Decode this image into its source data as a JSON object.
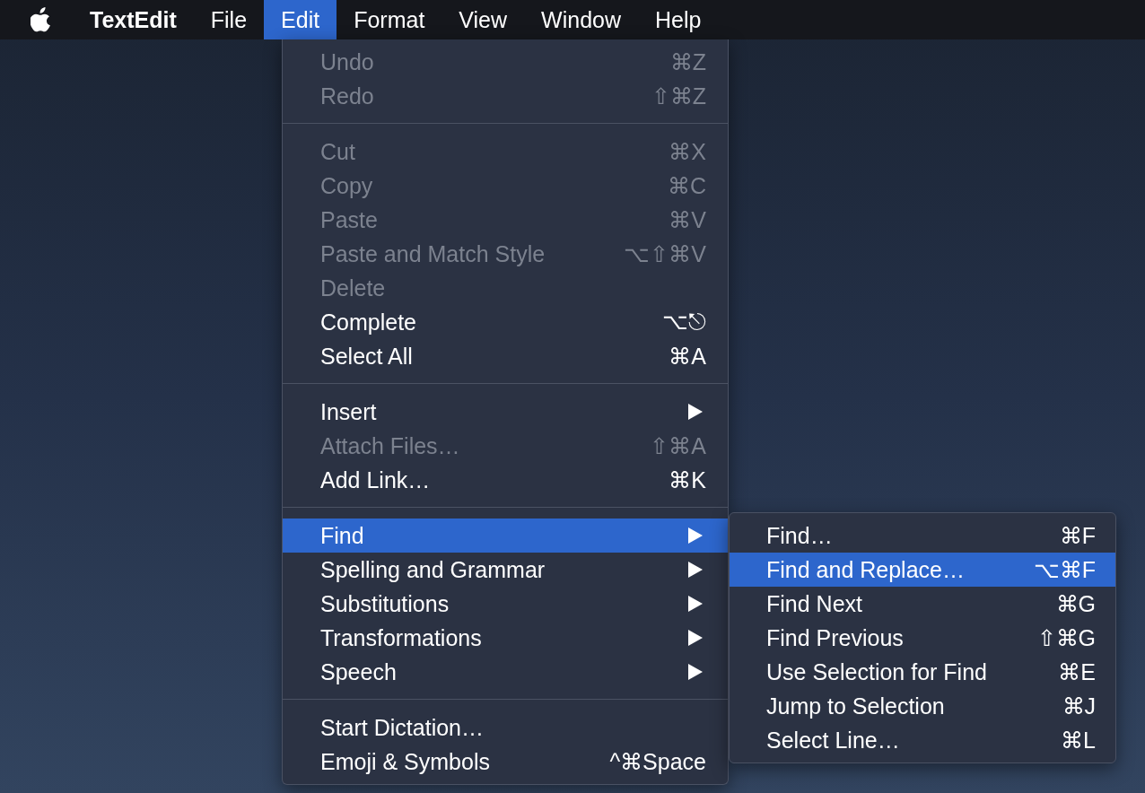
{
  "menu_bar": [
    {
      "kind": "apple",
      "selected": false
    },
    {
      "kind": "app",
      "label": "TextEdit",
      "selected": false
    },
    {
      "kind": "menu",
      "label": "File",
      "selected": false
    },
    {
      "kind": "menu",
      "label": "Edit",
      "selected": true
    },
    {
      "kind": "menu",
      "label": "Format",
      "selected": false
    },
    {
      "kind": "menu",
      "label": "View",
      "selected": false
    },
    {
      "kind": "menu",
      "label": "Window",
      "selected": false
    },
    {
      "kind": "menu",
      "label": "Help",
      "selected": false
    }
  ],
  "edit_menu": {
    "sections": [
      {
        "items": [
          {
            "label": "Undo",
            "shortcut": "⌘Z",
            "disabled": true,
            "selected": false,
            "submenu": false
          },
          {
            "label": "Redo",
            "shortcut": "⇧⌘Z",
            "disabled": true,
            "selected": false,
            "submenu": false
          }
        ]
      },
      {
        "items": [
          {
            "label": "Cut",
            "shortcut": "⌘X",
            "disabled": true,
            "selected": false,
            "submenu": false
          },
          {
            "label": "Copy",
            "shortcut": "⌘C",
            "disabled": true,
            "selected": false,
            "submenu": false
          },
          {
            "label": "Paste",
            "shortcut": "⌘V",
            "disabled": true,
            "selected": false,
            "submenu": false
          },
          {
            "label": "Paste and Match Style",
            "shortcut": "⌥⇧⌘V",
            "disabled": true,
            "selected": false,
            "submenu": false
          },
          {
            "label": "Delete",
            "disabled": true,
            "selected": false,
            "submenu": false
          },
          {
            "label": "Complete",
            "shortcut": "⌥⎋",
            "disabled": false,
            "selected": false,
            "submenu": false
          },
          {
            "label": "Select All",
            "shortcut": "⌘A",
            "disabled": false,
            "selected": false,
            "submenu": false
          }
        ]
      },
      {
        "items": [
          {
            "label": "Insert",
            "disabled": false,
            "selected": false,
            "submenu": true
          },
          {
            "label": "Attach Files…",
            "shortcut": "⇧⌘A",
            "disabled": true,
            "selected": false,
            "submenu": false
          },
          {
            "label": "Add Link…",
            "shortcut": "⌘K",
            "disabled": false,
            "selected": false,
            "submenu": false
          }
        ]
      },
      {
        "items": [
          {
            "label": "Find",
            "disabled": false,
            "selected": true,
            "submenu": true
          },
          {
            "label": "Spelling and Grammar",
            "disabled": false,
            "selected": false,
            "submenu": true
          },
          {
            "label": "Substitutions",
            "disabled": false,
            "selected": false,
            "submenu": true
          },
          {
            "label": "Transformations",
            "disabled": false,
            "selected": false,
            "submenu": true
          },
          {
            "label": "Speech",
            "disabled": false,
            "selected": false,
            "submenu": true
          }
        ]
      },
      {
        "items": [
          {
            "label": "Start Dictation…",
            "disabled": false,
            "selected": false,
            "submenu": false
          },
          {
            "label": "Emoji & Symbols",
            "shortcut": "^⌘Space",
            "disabled": false,
            "selected": false,
            "submenu": false
          }
        ]
      }
    ]
  },
  "find_submenu": {
    "items": [
      {
        "label": "Find…",
        "shortcut": "⌘F",
        "selected": false
      },
      {
        "label": "Find and Replace…",
        "shortcut": "⌥⌘F",
        "selected": true
      },
      {
        "label": "Find Next",
        "shortcut": "⌘G",
        "selected": false
      },
      {
        "label": "Find Previous",
        "shortcut": "⇧⌘G",
        "selected": false
      },
      {
        "label": "Use Selection for Find",
        "shortcut": "⌘E",
        "selected": false
      },
      {
        "label": "Jump to Selection",
        "shortcut": "⌘J",
        "selected": false
      },
      {
        "label": "Select Line…",
        "shortcut": "⌘L",
        "selected": false
      }
    ]
  }
}
